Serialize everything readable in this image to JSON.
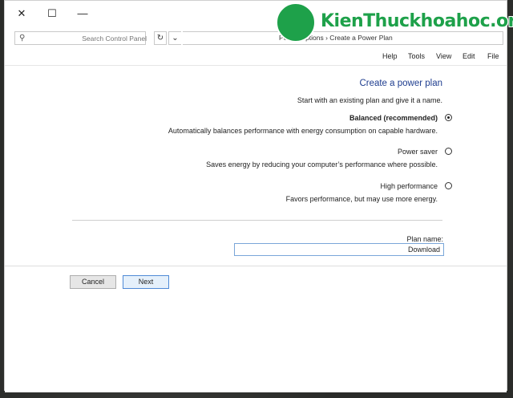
{
  "window": {
    "title": "Create a Power Plan",
    "controls": {
      "close": "✕",
      "maximize": "☐",
      "minimize": "—"
    }
  },
  "addressbar": {
    "search_placeholder": "Search Control Panel",
    "path": "Power Options › Create a Power Plan",
    "dropdown_icon": "chevron-down-icon",
    "refresh_icon": "refresh-icon"
  },
  "menu": {
    "items": [
      "File",
      "Edit",
      "View",
      "Tools",
      "Help"
    ]
  },
  "page": {
    "title": "Create a power plan",
    "subtitle": "Start with an existing plan and give it a name.",
    "plans": [
      {
        "name": "Balanced (recommended)",
        "description": "Automatically balances performance with energy consumption on capable hardware.",
        "selected": true
      },
      {
        "name": "Power saver",
        "description": "Saves energy by reducing your computer’s performance where possible.",
        "selected": false
      },
      {
        "name": "High performance",
        "description": "Favors performance, but may use more energy.",
        "selected": false
      }
    ],
    "plan_name_label": "Plan name:",
    "plan_name_value": "Download"
  },
  "buttons": {
    "next": "Next",
    "cancel": "Cancel"
  },
  "watermark": {
    "text_a": "Kien",
    "text_b": "Thuc",
    "text_c": "khoahoc",
    "text_d": ".org"
  },
  "colors": {
    "accent_title": "#1e3d8f",
    "primary_button_border": "#4f8ad6",
    "watermark_green": "#1ea14a"
  }
}
